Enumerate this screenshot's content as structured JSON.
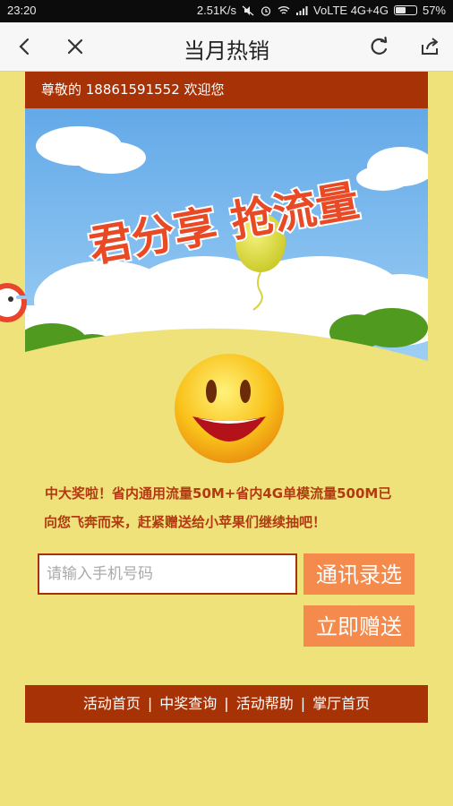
{
  "status_bar": {
    "time": "23:20",
    "speed": "2.51K/s",
    "network": "VoLTE 4G+4G",
    "battery": "57%",
    "battery_level": 0.57
  },
  "app_bar": {
    "title": "当月热销",
    "icons": [
      "back-icon",
      "close-icon",
      "refresh-icon",
      "share-icon"
    ]
  },
  "welcome": {
    "text": "尊敬的 18861591552 欢迎您"
  },
  "banner": {
    "headline": "君分享 抢流量"
  },
  "message": {
    "line1": "中大奖啦！省内通用流量50M+省内4G单模流量500M已",
    "line2": "向您飞奔而来，赶紧赠送给小苹果们继续抽吧！"
  },
  "form": {
    "phone_placeholder": "请输入手机号码",
    "contacts_button": "通讯录选择",
    "gift_button": "立即赠送"
  },
  "footer": {
    "links": [
      "活动首页",
      "中奖查询",
      "活动帮助",
      "掌厅首页"
    ]
  },
  "colors": {
    "page_bg": "#efe27a",
    "brand_red": "#a73205",
    "button_orange": "#f58a4d",
    "sky_blue": "#6fb5ee"
  }
}
